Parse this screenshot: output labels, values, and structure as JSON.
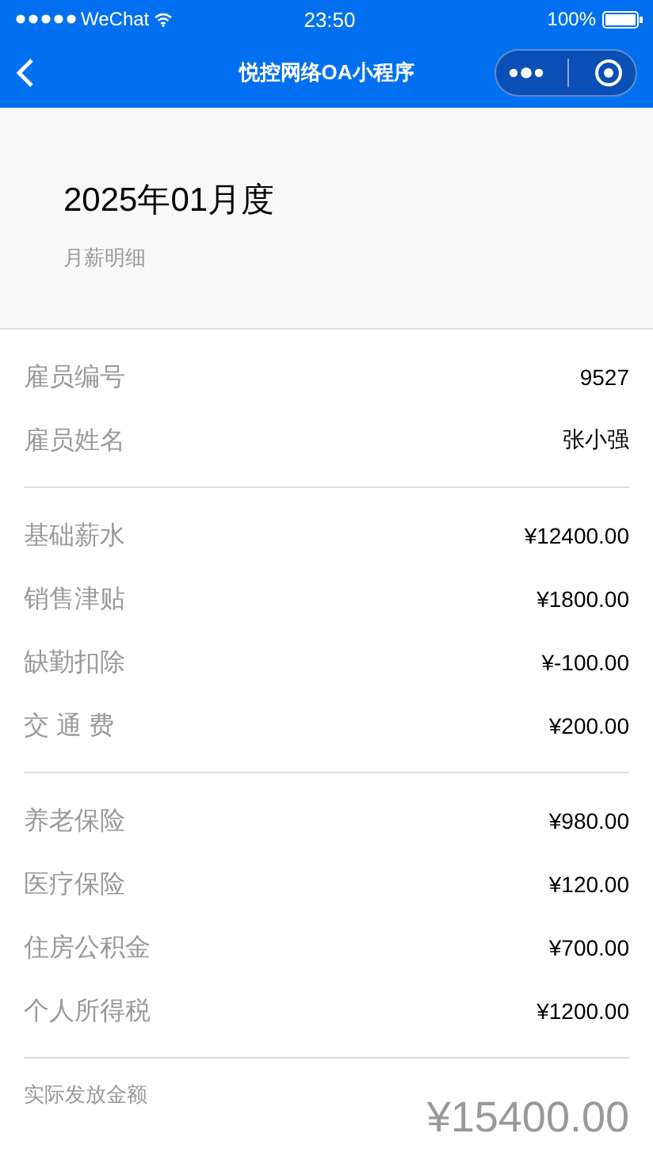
{
  "status_bar": {
    "carrier": "WeChat",
    "time": "23:50",
    "battery": "100%"
  },
  "nav_bar": {
    "title": "悦控网络OA小程序"
  },
  "header": {
    "period": "2025年01月度",
    "subtitle": "月薪明细"
  },
  "groups": [
    {
      "rows": [
        {
          "label": "雇员编号",
          "value": "9527"
        },
        {
          "label": "雇员姓名",
          "value": "张小强"
        }
      ]
    },
    {
      "rows": [
        {
          "label": "基础薪水",
          "value": "¥12400.00"
        },
        {
          "label": "销售津贴",
          "value": "¥1800.00"
        },
        {
          "label": "缺勤扣除",
          "value": "¥-100.00"
        },
        {
          "label": "交 通 费",
          "value": "¥200.00"
        }
      ]
    },
    {
      "rows": [
        {
          "label": "养老保险",
          "value": "¥980.00"
        },
        {
          "label": "医疗保险",
          "value": "¥120.00"
        },
        {
          "label": "住房公积金",
          "value": "¥700.00"
        },
        {
          "label": "个人所得税",
          "value": "¥1200.00"
        }
      ]
    }
  ],
  "total": {
    "label": "实际发放金额",
    "amount": "¥15400.00"
  }
}
